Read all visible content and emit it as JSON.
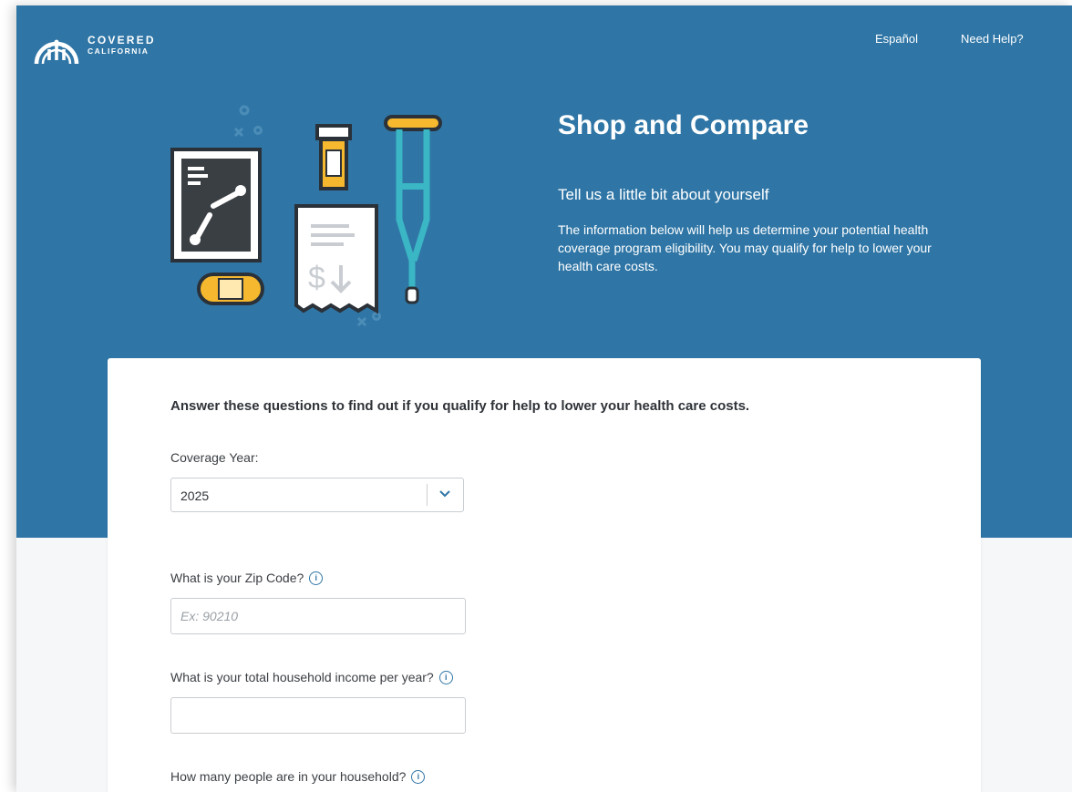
{
  "brand": {
    "line1": "COVERED",
    "line2": "CALIFORNIA"
  },
  "nav": {
    "espanol": "Español",
    "help": "Need Help?"
  },
  "hero": {
    "title": "Shop and Compare",
    "subtitle": "Tell us a little bit about yourself",
    "description": "The information below will help us determine your potential health coverage program eligibility. You may qualify for help to lower your health care costs."
  },
  "form": {
    "intro": "Answer these questions to find out if you qualify for help to lower your health care costs.",
    "coverage_year_label": "Coverage Year:",
    "coverage_year_value": "2025",
    "zip_label": "What is your Zip Code?",
    "zip_placeholder": "Ex: 90210",
    "income_label": "What is your total household income per year?",
    "income_value": "",
    "household_label": "How many people are in your household?"
  },
  "icons": {
    "info": "info-icon",
    "chevron": "chevron-down-icon",
    "logo": "covered-california-logo-icon"
  },
  "colors": {
    "hero_bg": "#2f76a6",
    "card_bg": "#ffffff",
    "accent_yellow": "#f5b82e",
    "accent_teal": "#3ab6c4",
    "dark": "#3a3f44"
  }
}
